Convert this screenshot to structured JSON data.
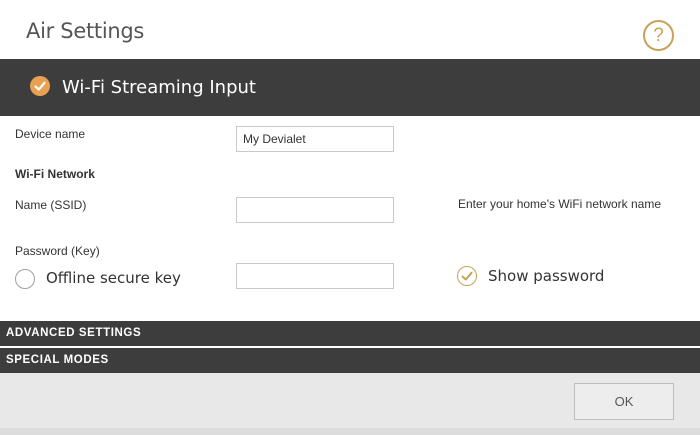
{
  "window": {
    "title": "Air Settings",
    "help_glyph": "?"
  },
  "section": {
    "label": "Wi-Fi Streaming Input",
    "enabled": true,
    "accent_color": "#e8a152"
  },
  "form": {
    "device_name_label": "Device name",
    "device_name_value": "My Devialet",
    "wifi_network_label": "Wi-Fi Network",
    "ssid_label": "Name (SSID)",
    "ssid_value": "",
    "ssid_hint": "Enter your home's WiFi network name",
    "password_label": "Password (Key)",
    "password_value": "",
    "offline_key_label": "Offline secure key",
    "offline_key_checked": false,
    "show_password_label": "Show password",
    "show_password_checked": true
  },
  "panels": {
    "advanced_label": "ADVANCED SETTINGS",
    "special_label": "SPECIAL MODES"
  },
  "footer": {
    "ok_label": "OK"
  },
  "colors": {
    "header_bg": "#3d3d3d",
    "accent": "#c8a15a"
  }
}
